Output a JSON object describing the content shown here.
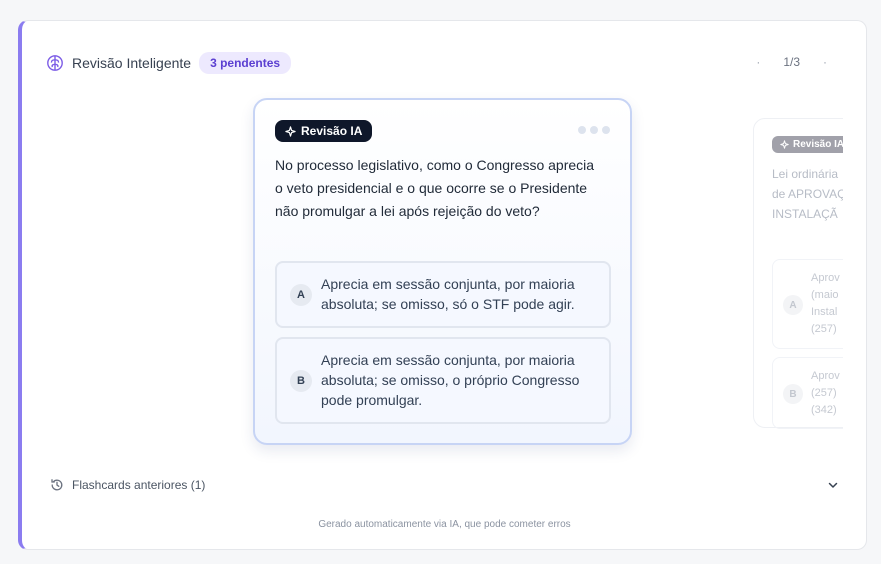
{
  "header": {
    "title": "Revisão Inteligente",
    "badge": "3 pendentes",
    "pager": {
      "current_label": "1/3",
      "prev_symbol": "·",
      "next_symbol": "·"
    },
    "icon": "brain-icon"
  },
  "card": {
    "tag": "Revisão IA",
    "tag_icon": "sparkle-icon",
    "question": "No processo legislativo, como o Congresso aprecia o veto presidencial e o que ocorre se o Presidente não promulgar a lei após rejeição do veto?",
    "options": [
      {
        "letter": "A",
        "text": "Aprecia em sessão conjunta, por maioria absoluta; se omisso, só o STF pode agir."
      },
      {
        "letter": "B",
        "text": "Aprecia em sessão conjunta, por maioria absoluta; se omisso, o próprio Congresso pode promulgar."
      }
    ]
  },
  "next_card": {
    "tag": "Revisão IA",
    "question_lines": [
      "Lei ordinária",
      "de APROVAÇ",
      "INSTALAÇÃ"
    ],
    "options": [
      {
        "letter": "A",
        "lines": [
          "Aprov",
          "(maio",
          "Instal",
          "(257)"
        ]
      },
      {
        "letter": "B",
        "lines": [
          "Aprov",
          "(257)",
          "(342)"
        ]
      }
    ]
  },
  "history": {
    "label": "Flashcards anteriores (1)",
    "icon": "history-icon"
  },
  "footer": {
    "text": "Gerado automaticamente via IA, que pode cometer erros"
  },
  "colors": {
    "accent": "#8b7cf0",
    "badge_bg": "#ede9fe",
    "badge_text": "#5b3fd1",
    "tag_bg": "#0f172a",
    "card_border": "#c7d4f5"
  }
}
